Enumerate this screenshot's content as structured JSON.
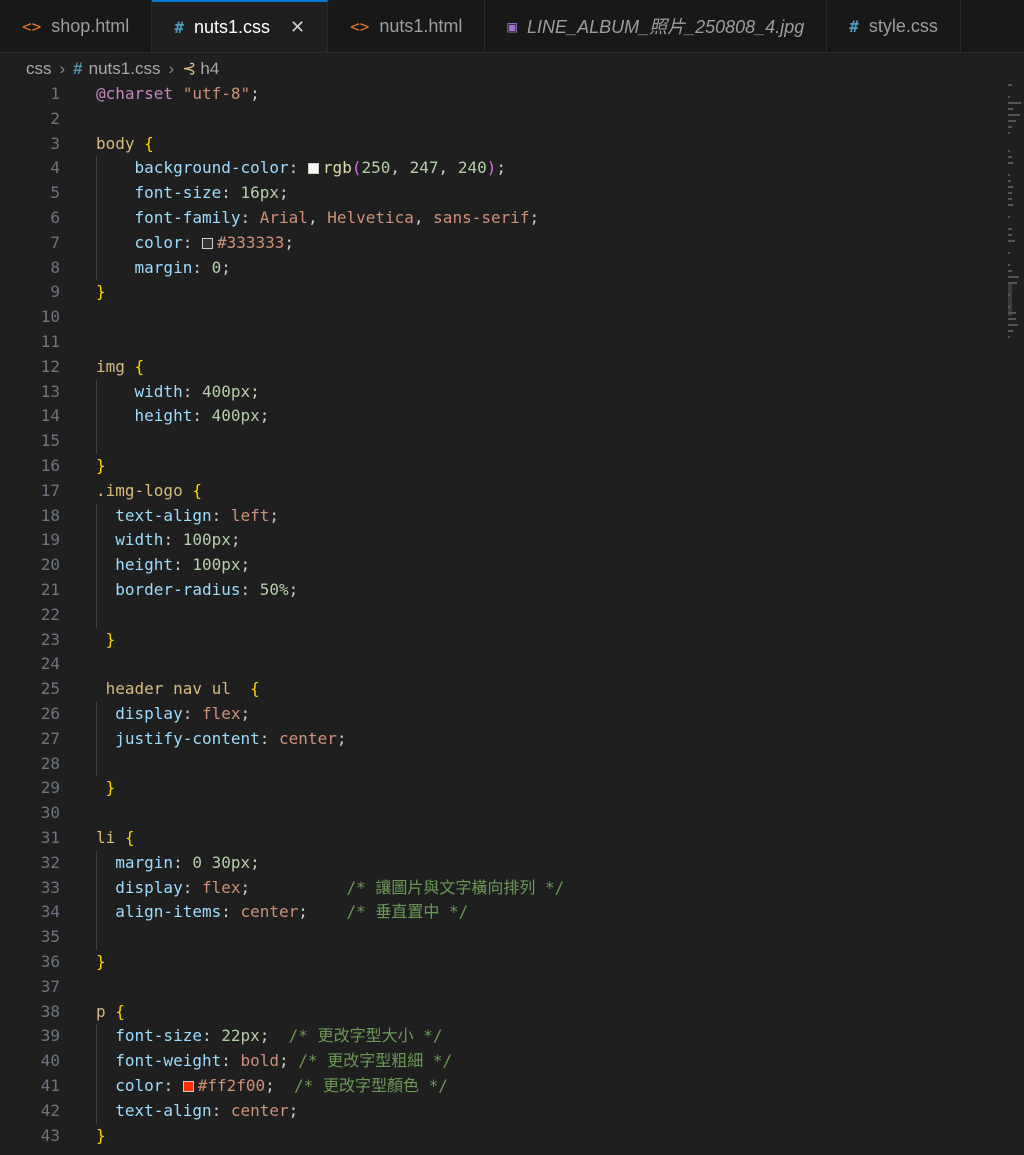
{
  "tabs": [
    {
      "label": "shop.html",
      "icon": "html-file-icon",
      "glyph": "<>",
      "kind": "html",
      "active": false,
      "italic": false
    },
    {
      "label": "nuts1.css",
      "icon": "css-file-icon",
      "glyph": "#",
      "kind": "css",
      "active": true,
      "italic": false,
      "close": "✕"
    },
    {
      "label": "nuts1.html",
      "icon": "html-file-icon",
      "glyph": "<>",
      "kind": "html",
      "active": false,
      "italic": false
    },
    {
      "label": "LINE_ALBUM_照片_250808_4.jpg",
      "icon": "image-file-icon",
      "glyph": "▣",
      "kind": "img",
      "active": false,
      "italic": true
    },
    {
      "label": "style.css",
      "icon": "css-file-icon",
      "glyph": "#",
      "kind": "css",
      "active": false,
      "italic": false
    }
  ],
  "breadcrumb": {
    "folder": "css",
    "separator": "›",
    "file": "nuts1.css",
    "symbol": "h4"
  },
  "colors": {
    "accent": "#0078d4",
    "swatch_white": "#faf7f0",
    "swatch_gray": "#333333",
    "swatch_red": "#ff2f00"
  },
  "code": [
    {
      "n": "1",
      "t": [
        [
          "k-at",
          "@charset"
        ],
        [
          "k-pl",
          " "
        ],
        [
          "k-str",
          "\"utf-8\""
        ],
        [
          "k-pl",
          ";"
        ]
      ]
    },
    {
      "n": "2",
      "t": []
    },
    {
      "n": "3",
      "t": [
        [
          "k-sel",
          "body"
        ],
        [
          "k-pl",
          " "
        ],
        [
          "k-br",
          "{"
        ]
      ]
    },
    {
      "n": "4",
      "t": [
        [
          "k-pl",
          "    "
        ],
        [
          "k-prop",
          "background-color"
        ],
        [
          "k-pl",
          ": "
        ],
        [
          "sw",
          "swatch_white"
        ],
        [
          "k-fn",
          "rgb"
        ],
        [
          "k-par",
          "("
        ],
        [
          "k-num",
          "250"
        ],
        [
          "k-pl",
          ", "
        ],
        [
          "k-num",
          "247"
        ],
        [
          "k-pl",
          ", "
        ],
        [
          "k-num",
          "240"
        ],
        [
          "k-par",
          ")"
        ],
        [
          "k-pl",
          ";"
        ]
      ]
    },
    {
      "n": "5",
      "t": [
        [
          "k-pl",
          "    "
        ],
        [
          "k-prop",
          "font-size"
        ],
        [
          "k-pl",
          ": "
        ],
        [
          "k-num",
          "16px"
        ],
        [
          "k-pl",
          ";"
        ]
      ]
    },
    {
      "n": "6",
      "t": [
        [
          "k-pl",
          "    "
        ],
        [
          "k-prop",
          "font-family"
        ],
        [
          "k-pl",
          ": "
        ],
        [
          "k-val",
          "Arial"
        ],
        [
          "k-pl",
          ", "
        ],
        [
          "k-val",
          "Helvetica"
        ],
        [
          "k-pl",
          ", "
        ],
        [
          "k-val",
          "sans-serif"
        ],
        [
          "k-pl",
          ";"
        ]
      ]
    },
    {
      "n": "7",
      "t": [
        [
          "k-pl",
          "    "
        ],
        [
          "k-prop",
          "color"
        ],
        [
          "k-pl",
          ": "
        ],
        [
          "sw",
          "swatch_gray"
        ],
        [
          "k-val",
          "#333333"
        ],
        [
          "k-pl",
          ";"
        ]
      ]
    },
    {
      "n": "8",
      "t": [
        [
          "k-pl",
          "    "
        ],
        [
          "k-prop",
          "margin"
        ],
        [
          "k-pl",
          ": "
        ],
        [
          "k-num",
          "0"
        ],
        [
          "k-pl",
          ";"
        ]
      ]
    },
    {
      "n": "9",
      "t": [
        [
          "k-br",
          "}"
        ]
      ]
    },
    {
      "n": "10",
      "t": []
    },
    {
      "n": "11",
      "t": []
    },
    {
      "n": "12",
      "t": [
        [
          "k-sel",
          "img"
        ],
        [
          "k-pl",
          " "
        ],
        [
          "k-br",
          "{"
        ]
      ]
    },
    {
      "n": "13",
      "t": [
        [
          "k-pl",
          "    "
        ],
        [
          "k-prop",
          "width"
        ],
        [
          "k-pl",
          ": "
        ],
        [
          "k-num",
          "400px"
        ],
        [
          "k-pl",
          ";"
        ]
      ]
    },
    {
      "n": "14",
      "t": [
        [
          "k-pl",
          "    "
        ],
        [
          "k-prop",
          "height"
        ],
        [
          "k-pl",
          ": "
        ],
        [
          "k-num",
          "400px"
        ],
        [
          "k-pl",
          ";"
        ]
      ]
    },
    {
      "n": "15",
      "t": []
    },
    {
      "n": "16",
      "t": [
        [
          "k-br",
          "}"
        ]
      ]
    },
    {
      "n": "17",
      "t": [
        [
          "k-sel",
          ".img-logo"
        ],
        [
          "k-pl",
          " "
        ],
        [
          "k-br",
          "{"
        ]
      ]
    },
    {
      "n": "18",
      "t": [
        [
          "k-pl",
          "  "
        ],
        [
          "k-prop",
          "text-align"
        ],
        [
          "k-pl",
          ": "
        ],
        [
          "k-val",
          "left"
        ],
        [
          "k-pl",
          ";"
        ]
      ]
    },
    {
      "n": "19",
      "t": [
        [
          "k-pl",
          "  "
        ],
        [
          "k-prop",
          "width"
        ],
        [
          "k-pl",
          ": "
        ],
        [
          "k-num",
          "100px"
        ],
        [
          "k-pl",
          ";"
        ]
      ]
    },
    {
      "n": "20",
      "t": [
        [
          "k-pl",
          "  "
        ],
        [
          "k-prop",
          "height"
        ],
        [
          "k-pl",
          ": "
        ],
        [
          "k-num",
          "100px"
        ],
        [
          "k-pl",
          ";"
        ]
      ]
    },
    {
      "n": "21",
      "t": [
        [
          "k-pl",
          "  "
        ],
        [
          "k-prop",
          "border-radius"
        ],
        [
          "k-pl",
          ": "
        ],
        [
          "k-num",
          "50%"
        ],
        [
          "k-pl",
          ";"
        ]
      ]
    },
    {
      "n": "22",
      "t": []
    },
    {
      "n": "23",
      "t": [
        [
          "k-pl",
          " "
        ],
        [
          "k-br",
          "}"
        ]
      ]
    },
    {
      "n": "24",
      "t": []
    },
    {
      "n": "25",
      "t": [
        [
          "k-pl",
          " "
        ],
        [
          "k-sel",
          "header nav ul"
        ],
        [
          "k-pl",
          "  "
        ],
        [
          "k-br",
          "{"
        ]
      ]
    },
    {
      "n": "26",
      "t": [
        [
          "k-pl",
          "  "
        ],
        [
          "k-prop",
          "display"
        ],
        [
          "k-pl",
          ": "
        ],
        [
          "k-val",
          "flex"
        ],
        [
          "k-pl",
          ";"
        ]
      ]
    },
    {
      "n": "27",
      "t": [
        [
          "k-pl",
          "  "
        ],
        [
          "k-prop",
          "justify-content"
        ],
        [
          "k-pl",
          ": "
        ],
        [
          "k-val",
          "center"
        ],
        [
          "k-pl",
          ";"
        ]
      ]
    },
    {
      "n": "28",
      "t": []
    },
    {
      "n": "29",
      "t": [
        [
          "k-pl",
          " "
        ],
        [
          "k-br",
          "}"
        ]
      ]
    },
    {
      "n": "30",
      "t": []
    },
    {
      "n": "31",
      "t": [
        [
          "k-sel",
          "li"
        ],
        [
          "k-pl",
          " "
        ],
        [
          "k-br",
          "{"
        ]
      ]
    },
    {
      "n": "32",
      "t": [
        [
          "k-pl",
          "  "
        ],
        [
          "k-prop",
          "margin"
        ],
        [
          "k-pl",
          ": "
        ],
        [
          "k-num",
          "0"
        ],
        [
          "k-pl",
          " "
        ],
        [
          "k-num",
          "30px"
        ],
        [
          "k-pl",
          ";"
        ]
      ]
    },
    {
      "n": "33",
      "t": [
        [
          "k-pl",
          "  "
        ],
        [
          "k-prop",
          "display"
        ],
        [
          "k-pl",
          ": "
        ],
        [
          "k-val",
          "flex"
        ],
        [
          "k-pl",
          ";          "
        ],
        [
          "k-com",
          "/* 讓圖片與文字橫向排列 */"
        ]
      ]
    },
    {
      "n": "34",
      "t": [
        [
          "k-pl",
          "  "
        ],
        [
          "k-prop",
          "align-items"
        ],
        [
          "k-pl",
          ": "
        ],
        [
          "k-val",
          "center"
        ],
        [
          "k-pl",
          ";    "
        ],
        [
          "k-com",
          "/* 垂直置中 */"
        ]
      ]
    },
    {
      "n": "35",
      "t": []
    },
    {
      "n": "36",
      "t": [
        [
          "k-br",
          "}"
        ]
      ]
    },
    {
      "n": "37",
      "t": []
    },
    {
      "n": "38",
      "t": [
        [
          "k-sel",
          "p"
        ],
        [
          "k-pl",
          " "
        ],
        [
          "k-br",
          "{"
        ]
      ]
    },
    {
      "n": "39",
      "t": [
        [
          "k-pl",
          "  "
        ],
        [
          "k-prop",
          "font-size"
        ],
        [
          "k-pl",
          ": "
        ],
        [
          "k-num",
          "22px"
        ],
        [
          "k-pl",
          ";  "
        ],
        [
          "k-com",
          "/* 更改字型大小 */"
        ]
      ]
    },
    {
      "n": "40",
      "t": [
        [
          "k-pl",
          "  "
        ],
        [
          "k-prop",
          "font-weight"
        ],
        [
          "k-pl",
          ": "
        ],
        [
          "k-val",
          "bold"
        ],
        [
          "k-pl",
          "; "
        ],
        [
          "k-com",
          "/* 更改字型粗細 */"
        ]
      ]
    },
    {
      "n": "41",
      "t": [
        [
          "k-pl",
          "  "
        ],
        [
          "k-prop",
          "color"
        ],
        [
          "k-pl",
          ": "
        ],
        [
          "sw",
          "swatch_red"
        ],
        [
          "k-val",
          "#ff2f00"
        ],
        [
          "k-pl",
          ";  "
        ],
        [
          "k-com",
          "/* 更改字型顏色 */"
        ]
      ]
    },
    {
      "n": "42",
      "t": [
        [
          "k-pl",
          "  "
        ],
        [
          "k-prop",
          "text-align"
        ],
        [
          "k-pl",
          ": "
        ],
        [
          "k-val",
          "center"
        ],
        [
          "k-pl",
          ";"
        ]
      ]
    },
    {
      "n": "43",
      "t": [
        [
          "k-br",
          "}"
        ]
      ]
    }
  ]
}
